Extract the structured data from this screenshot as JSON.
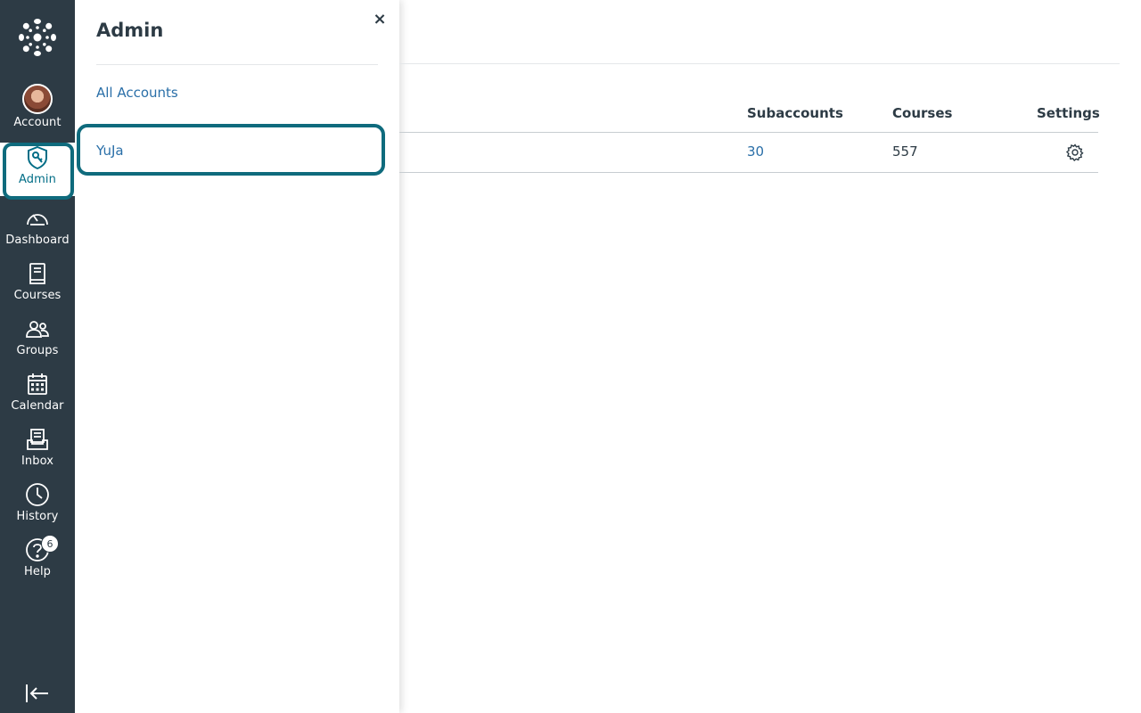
{
  "global_nav": {
    "items": [
      {
        "label": "Account",
        "icon": "avatar"
      },
      {
        "label": "Admin",
        "icon": "admin-shield-icon"
      },
      {
        "label": "Dashboard",
        "icon": "dashboard-gauge-icon"
      },
      {
        "label": "Courses",
        "icon": "courses-book-icon"
      },
      {
        "label": "Groups",
        "icon": "groups-people-icon"
      },
      {
        "label": "Calendar",
        "icon": "calendar-icon"
      },
      {
        "label": "Inbox",
        "icon": "inbox-icon"
      },
      {
        "label": "History",
        "icon": "history-clock-icon"
      },
      {
        "label": "Help",
        "icon": "help-question-icon"
      }
    ],
    "help_badge": "6",
    "active": "Admin",
    "accent_color": "#0f6b7d",
    "bg_color": "#2d3b45"
  },
  "tray": {
    "title": "Admin",
    "close_icon": "×",
    "links": [
      "All Accounts",
      "YuJa"
    ],
    "focused": "YuJa"
  },
  "table": {
    "headers": [
      "Subaccounts",
      "Courses",
      "Settings"
    ],
    "rows": [
      {
        "subaccounts": "30",
        "courses": "557",
        "settings_icon": "gear-icon"
      }
    ]
  }
}
